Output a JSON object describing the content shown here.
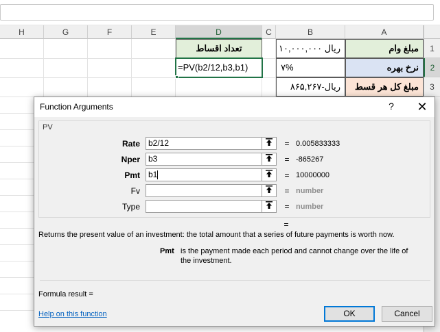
{
  "spreadsheet": {
    "columns": [
      "H",
      "G",
      "F",
      "E",
      "D",
      "C",
      "B",
      "A"
    ],
    "rows": [
      "1",
      "2",
      "3"
    ],
    "cells": {
      "D1": "تعداد اقساط",
      "D2": "=PV(b2/12,b3,b1)",
      "B1": "ریال  ۱۰,۰۰۰,۰۰۰",
      "A1": "مبلغ وام",
      "B2": "۷%",
      "A2": "نرخ بهره",
      "B3": "ریال-۸۶۵,۲۶۷",
      "A3": "مبلغ کل هر قسط"
    }
  },
  "dialog": {
    "title": "Function Arguments",
    "help_glyph": "?",
    "close_glyph": "✕",
    "function_name": "PV",
    "args": [
      {
        "label": "Rate",
        "value": "b2/12",
        "result": "0.005833333",
        "required": true
      },
      {
        "label": "Nper",
        "value": "b3",
        "result": "-865267",
        "required": true
      },
      {
        "label": "Pmt",
        "value": "b1",
        "result": "10000000",
        "required": true
      },
      {
        "label": "Fv",
        "value": "",
        "result": "number",
        "required": false
      },
      {
        "label": "Type",
        "value": "",
        "result": "number",
        "required": false
      }
    ],
    "eq": "=",
    "summary_eq": "=",
    "description": "Returns the present value of an investment: the total amount that a series of future payments is worth now.",
    "param_name": "Pmt",
    "param_desc_line1": "is the payment made each period and cannot change over the life of",
    "param_desc_line2": "the investment.",
    "formula_result": "Formula result =",
    "help_link": "Help on this function",
    "ok": "OK",
    "cancel": "Cancel"
  },
  "colors": {
    "header_green": "#e2efda",
    "header_blue": "#dae3f3",
    "header_orange": "#fce4d6",
    "accent": "#217346",
    "focus_blue": "#0078d7"
  }
}
